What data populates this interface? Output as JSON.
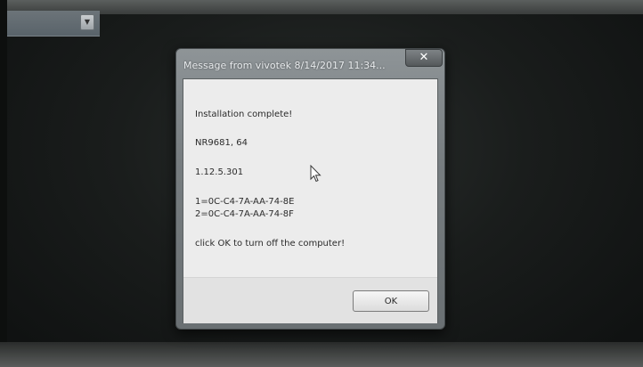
{
  "dialog": {
    "title": "Message from vivotek 8/14/2017 11:34...",
    "close_glyph": "✕",
    "close_icon": "close-icon",
    "message": {
      "status": "Installation complete!",
      "model": "NR9681, 64",
      "version": "1.12.5.301",
      "mac_1": "1=0C-C4-7A-AA-74-8E",
      "mac_2": "2=0C-C4-7A-AA-74-8F",
      "instruction": "click OK to turn off the computer!"
    },
    "ok_label": "OK"
  },
  "background": {
    "dropdown_icon": "chevron-down-icon"
  },
  "cursor_icon": "mouse-pointer-icon"
}
